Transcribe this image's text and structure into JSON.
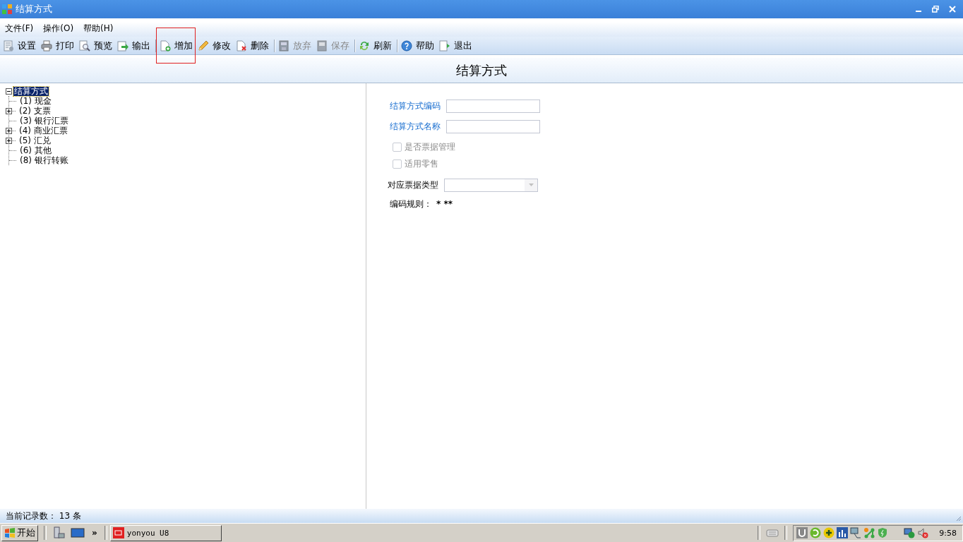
{
  "window": {
    "title": "结算方式"
  },
  "menu": [
    {
      "label": "文件(F)"
    },
    {
      "label": "操作(O)"
    },
    {
      "label": "帮助(H)"
    }
  ],
  "toolbar": [
    {
      "kind": "settings",
      "label": "设置",
      "disabled": false,
      "separator_before": false,
      "highlighted": false
    },
    {
      "kind": "print",
      "label": "打印",
      "disabled": false,
      "separator_before": false,
      "highlighted": false
    },
    {
      "kind": "preview",
      "label": "预览",
      "disabled": false,
      "separator_before": false,
      "highlighted": false
    },
    {
      "kind": "export",
      "label": "输出",
      "disabled": false,
      "separator_before": false,
      "highlighted": false
    },
    {
      "kind": "add",
      "label": "增加",
      "disabled": false,
      "separator_before": true,
      "highlighted": true
    },
    {
      "kind": "edit",
      "label": "修改",
      "disabled": false,
      "separator_before": false,
      "highlighted": false
    },
    {
      "kind": "delete",
      "label": "删除",
      "disabled": false,
      "separator_before": false,
      "highlighted": false
    },
    {
      "kind": "discard",
      "label": "放弃",
      "disabled": true,
      "separator_before": true,
      "highlighted": false
    },
    {
      "kind": "save",
      "label": "保存",
      "disabled": true,
      "separator_before": false,
      "highlighted": false
    },
    {
      "kind": "refresh",
      "label": "刷新",
      "disabled": false,
      "separator_before": true,
      "highlighted": false
    },
    {
      "kind": "help",
      "label": "帮助",
      "disabled": false,
      "separator_before": true,
      "highlighted": false
    },
    {
      "kind": "exit",
      "label": "退出",
      "disabled": false,
      "separator_before": false,
      "highlighted": false
    }
  ],
  "heading": "结算方式",
  "tree": {
    "label": "结算方式",
    "expanded": true,
    "selected": true,
    "children": [
      {
        "label": "(1) 现金",
        "selected": false
      },
      {
        "label": "(2) 支票",
        "selected": false,
        "expanded": false
      },
      {
        "label": "(3) 银行汇票",
        "selected": false
      },
      {
        "label": "(4) 商业汇票",
        "selected": false,
        "expanded": false
      },
      {
        "label": "(5) 汇兑",
        "selected": false,
        "expanded": false
      },
      {
        "label": "(6) 其他",
        "selected": false
      },
      {
        "label": "(8) 银行转账",
        "selected": false
      }
    ]
  },
  "form": [
    {
      "kind": "text",
      "label": "结算方式编码",
      "required": true
    },
    {
      "kind": "text",
      "label": "结算方式名称",
      "required": true
    },
    {
      "kind": "checkbox",
      "label": "是否票据管理",
      "checked": false,
      "disabled": true
    },
    {
      "kind": "checkbox",
      "label": "适用零售",
      "checked": false,
      "disabled": true
    },
    {
      "kind": "select",
      "label": "对应票据类型",
      "disabled": true
    },
    {
      "kind": "rule",
      "label": "编码规则：",
      "value": "* **"
    }
  ],
  "status_bar": "当前记录数： 13 条",
  "taskbar": {
    "start": "开始",
    "more": "»",
    "tasks": [
      {
        "label": "yonyou U8",
        "selected": false
      }
    ],
    "clock": "9:58"
  }
}
